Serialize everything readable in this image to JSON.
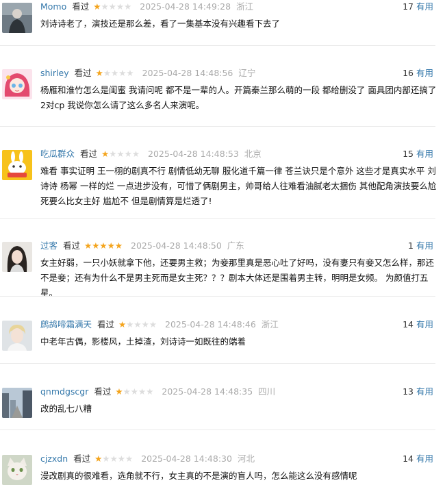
{
  "comments": [
    {
      "user": "Momo",
      "watched": "看过",
      "rating": 1,
      "time": "2025-04-28 14:49:28",
      "location": "浙江",
      "votes": "17",
      "useful_label": "有用",
      "text": "刘诗诗老了，演技还是那么差，看了一集基本没有兴趣看下去了",
      "avatar_icon": "dark-portrait-icon",
      "accent": "#37a"
    },
    {
      "user": "shirley",
      "watched": "看过",
      "rating": 1,
      "time": "2025-04-28 14:48:56",
      "location": "辽宁",
      "votes": "16",
      "useful_label": "有用",
      "text": "杨雁和淮竹怎么是闺蜜 我请问呢 都不是一辈的人。开篇秦兰那么萌的一段 都给删没了 面具团内部还搞了2对cp 我说你怎么请了这么多名人来演呢。",
      "avatar_icon": "anime-girl-icon"
    },
    {
      "user": "吃瓜群众",
      "watched": "看过",
      "rating": 1,
      "time": "2025-04-28 14:48:53",
      "location": "北京",
      "votes": "15",
      "useful_label": "有用",
      "text": "难看 事实证明 王一栩的剧真不行 剧情低幼无聊 服化道千篇一律 苍兰诀只是个意外 这些才是真实水平 刘诗诗 杨幂 一样的烂 一点进步没有，可惜了俩剧男主，帅哥给人往难看油腻老太捆伤 其他配角演技要么尬死要么比女主好 尴尬不 但是剧情算是烂透了!",
      "avatar_icon": "bunny-sticker-icon"
    },
    {
      "user": "过客",
      "watched": "看过",
      "rating": 5,
      "time": "2025-04-28 14:48:50",
      "location": "广东",
      "votes": "1",
      "useful_label": "有用",
      "text": "女主好弱，一只小妖就拿下他，还要男主救；为妾那里真是恶心吐了好吗，没有妻只有妾又怎么样，那还不是妾；还有为什么不是男主死而是女主死？？？剧本大体还是围着男主转，明明是女频。 为颜值打五星。",
      "avatar_icon": "girl-portrait-icon"
    },
    {
      "user": "鹧鸪啼霜满天",
      "watched": "看过",
      "rating": 1,
      "time": "2025-04-28 14:48:46",
      "location": "浙江",
      "votes": "14",
      "useful_label": "有用",
      "text": "中老年古偶，影楼风，土掉渣，刘诗诗一如既往的端着",
      "avatar_icon": "blond-man-icon"
    },
    {
      "user": "qnmdgscgr",
      "watched": "看过",
      "rating": 1,
      "time": "2025-04-28 14:48:35",
      "location": "四川",
      "votes": "13",
      "useful_label": "有用",
      "text": "改的乱七八糟",
      "avatar_icon": "city-street-icon"
    },
    {
      "user": "cjzxdn",
      "watched": "看过",
      "rating": 1,
      "time": "2025-04-28 14:48:30",
      "location": "河北",
      "votes": "14",
      "useful_label": "有用",
      "text": "漫改剧真的很难看，选角就不行，女主真的不是演的盲人吗，怎么能这么没有感情呢",
      "avatar_icon": "cat-photo-icon"
    }
  ]
}
